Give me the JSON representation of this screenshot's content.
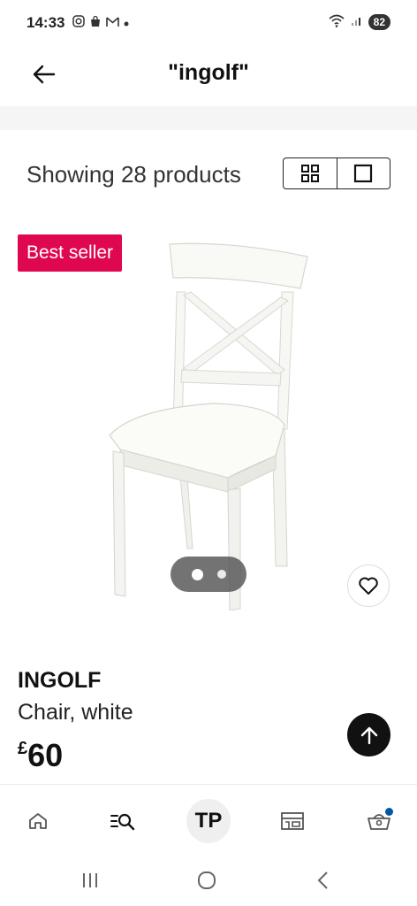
{
  "status_bar": {
    "time": "14:33",
    "notification_icons": [
      "instagram-icon",
      "shopping-bag-icon",
      "gmail-icon",
      "dot-icon"
    ],
    "battery": "82"
  },
  "header": {
    "title": "\"ingolf\"",
    "back_icon": "arrow-left-icon"
  },
  "results": {
    "count_text": "Showing 28 products",
    "view_modes": [
      "grid",
      "single"
    ],
    "active_view": "single"
  },
  "product": {
    "badge": "Best seller",
    "badge_color": "#e00751",
    "name": "INGOLF",
    "description": "Chair, white",
    "price_currency": "£",
    "price_value": "60",
    "image_count": 2,
    "active_image": 1
  },
  "bottom_nav": {
    "items": [
      "home",
      "search",
      "profile",
      "store",
      "basket"
    ],
    "avatar_initials": "TP",
    "basket_indicator_color": "#0058a3"
  },
  "system_nav": [
    "recents",
    "home",
    "back"
  ]
}
